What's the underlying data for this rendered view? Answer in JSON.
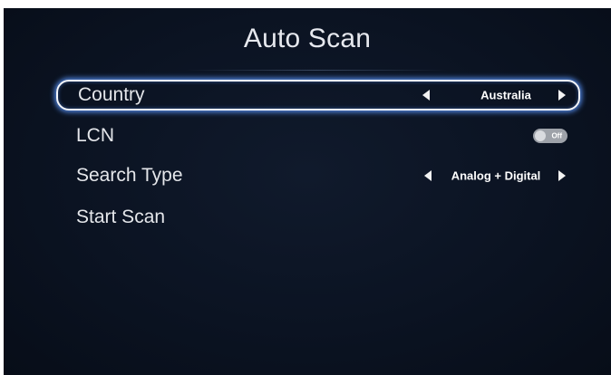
{
  "screen": {
    "title": "Auto Scan"
  },
  "menu": {
    "country": {
      "label": "Country",
      "value": "Australia",
      "focused": true
    },
    "lcn": {
      "label": "LCN",
      "toggle_text": "Off",
      "state": "off"
    },
    "search_type": {
      "label": "Search Type",
      "value": "Analog + Digital"
    },
    "start_scan": {
      "label": "Start Scan"
    }
  },
  "icons": {
    "left": "arrow-left-icon",
    "right": "arrow-right-icon"
  },
  "colors": {
    "background": "#0b1322",
    "focus_glow": "#5a96ff",
    "text": "#e4e6ea"
  }
}
